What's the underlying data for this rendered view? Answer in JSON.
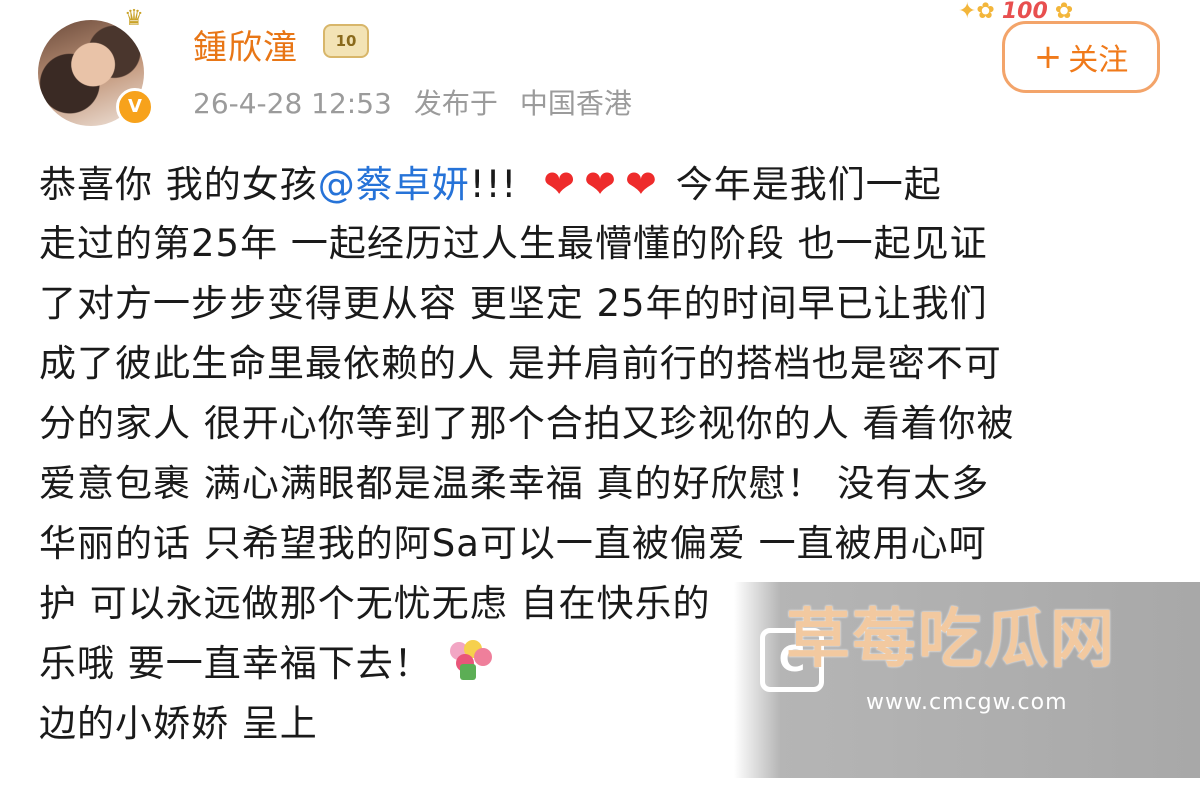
{
  "header": {
    "username": "鍾欣潼",
    "vip_badge": "10",
    "timestamp": "26-4-28 12:53",
    "published_label": "发布于",
    "location": "中国香港",
    "follow_label": "关注",
    "decoration_text": "100"
  },
  "post": {
    "lines": [
      {
        "t1": "恭喜你 我的女孩",
        "mention": "@蔡卓妍",
        "t2": "!!!",
        "hearts": "❤❤❤",
        "t3": "今年是我们一起"
      },
      "走过的第25年 一起经历过人生最懵懂的阶段 也一起见证",
      "了对方一步步变得更从容 更坚定 25年的时间早已让我们",
      "成了彼此生命里最依赖的人 是并肩前行的搭档也是密不可",
      "分的家人 很开心你等到了那个合拍又珍视你的人 看着你被",
      "爱意包裹 满心满眼都是温柔幸福 真的好欣慰！ 没有太多",
      "华丽的话 只希望我的阿Sa可以一直被偏爱 一直被用心呵",
      "护 可以永远做那个无忧无虑 自在快乐的",
      "乐哦 要一直幸福下去！",
      "边的小娇娇 呈上"
    ]
  },
  "watermark": {
    "title": "草莓吃瓜网",
    "url": "www.cmcgw.com",
    "logo": "C"
  },
  "icons": {
    "avatar": "avatar",
    "verified": "verified-badge-icon",
    "vip": "vip-crown-icon",
    "flower": "flower-bouquet-icon"
  },
  "colors": {
    "username": "#e87616",
    "mention": "#2673d8",
    "follow": "#f07a1a",
    "meta": "#9b9b9b",
    "heart": "#ee2b2b"
  }
}
